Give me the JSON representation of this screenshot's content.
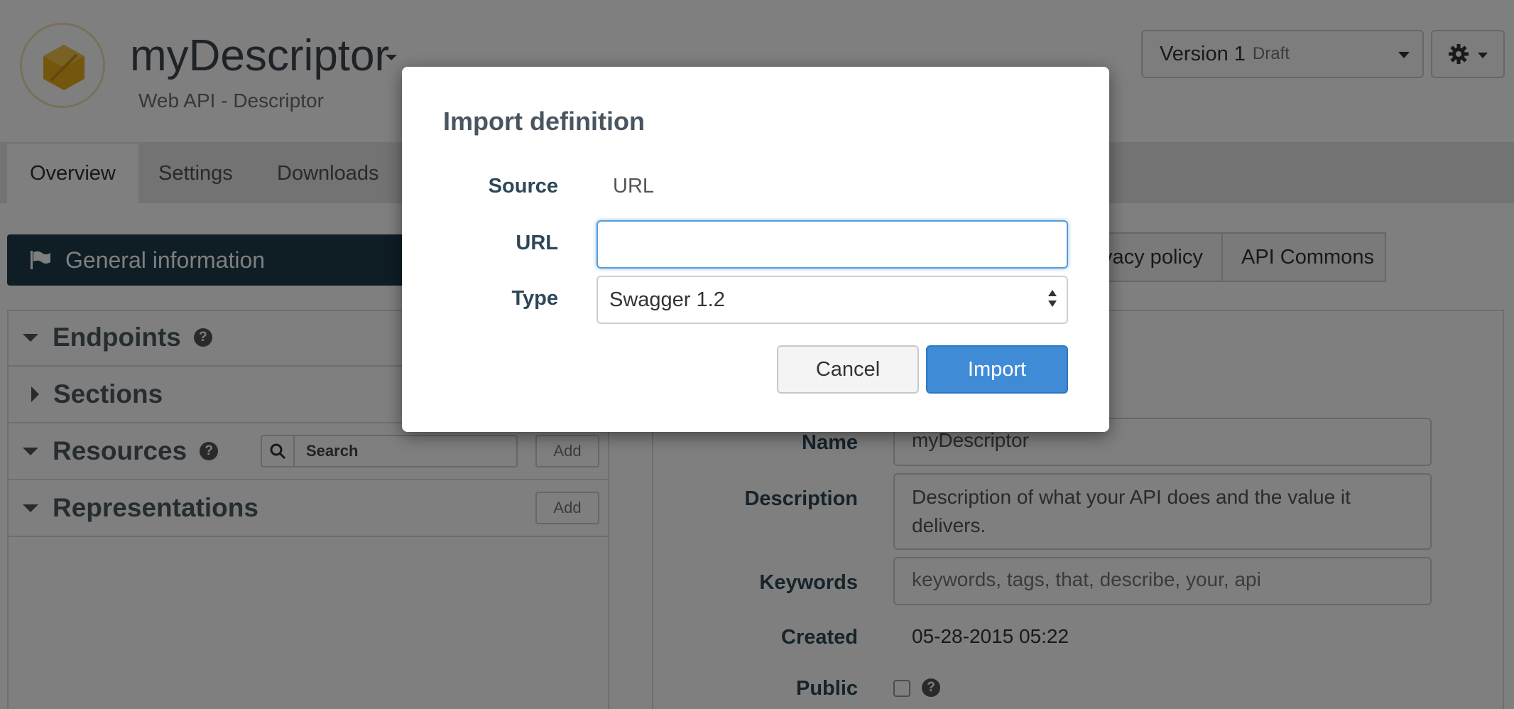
{
  "header": {
    "title": "myDescriptor",
    "subtitle": "Web API - Descriptor",
    "version_label": "Version 1",
    "version_state": "Draft"
  },
  "tabs": [
    {
      "label": "Overview",
      "active": true
    },
    {
      "label": "Settings",
      "active": false
    },
    {
      "label": "Downloads",
      "active": false
    }
  ],
  "left": {
    "general_info": "General information",
    "endpoints": "Endpoints",
    "sections": "Sections",
    "resources": "Resources",
    "representations": "Representations",
    "search_placeholder": "Search",
    "add_label": "Add"
  },
  "right": {
    "tab_privacy": "vacy policy",
    "tab_api_commons": "API Commons",
    "name_label": "Name",
    "name_value": "myDescriptor",
    "description_label": "Description",
    "description_value": "Description of what your API does and the value it delivers.",
    "keywords_label": "Keywords",
    "keywords_placeholder": "keywords, tags, that, describe, your, api",
    "created_label": "Created",
    "created_value": "05-28-2015 05:22",
    "public_label": "Public"
  },
  "modal": {
    "title": "Import definition",
    "source_label": "Source",
    "source_value": "URL",
    "url_label": "URL",
    "url_value": "",
    "type_label": "Type",
    "type_value": "Swagger 1.2",
    "cancel_label": "Cancel",
    "import_label": "Import"
  },
  "colors": {
    "primary": "#3f8bd6",
    "navy": "#1e3a4a",
    "logo_hex": "#e8ad1c"
  },
  "icons": [
    "hexagon-logo-icon",
    "caret-down-icon",
    "gear-icon",
    "flag-icon",
    "search-icon",
    "help-icon"
  ]
}
